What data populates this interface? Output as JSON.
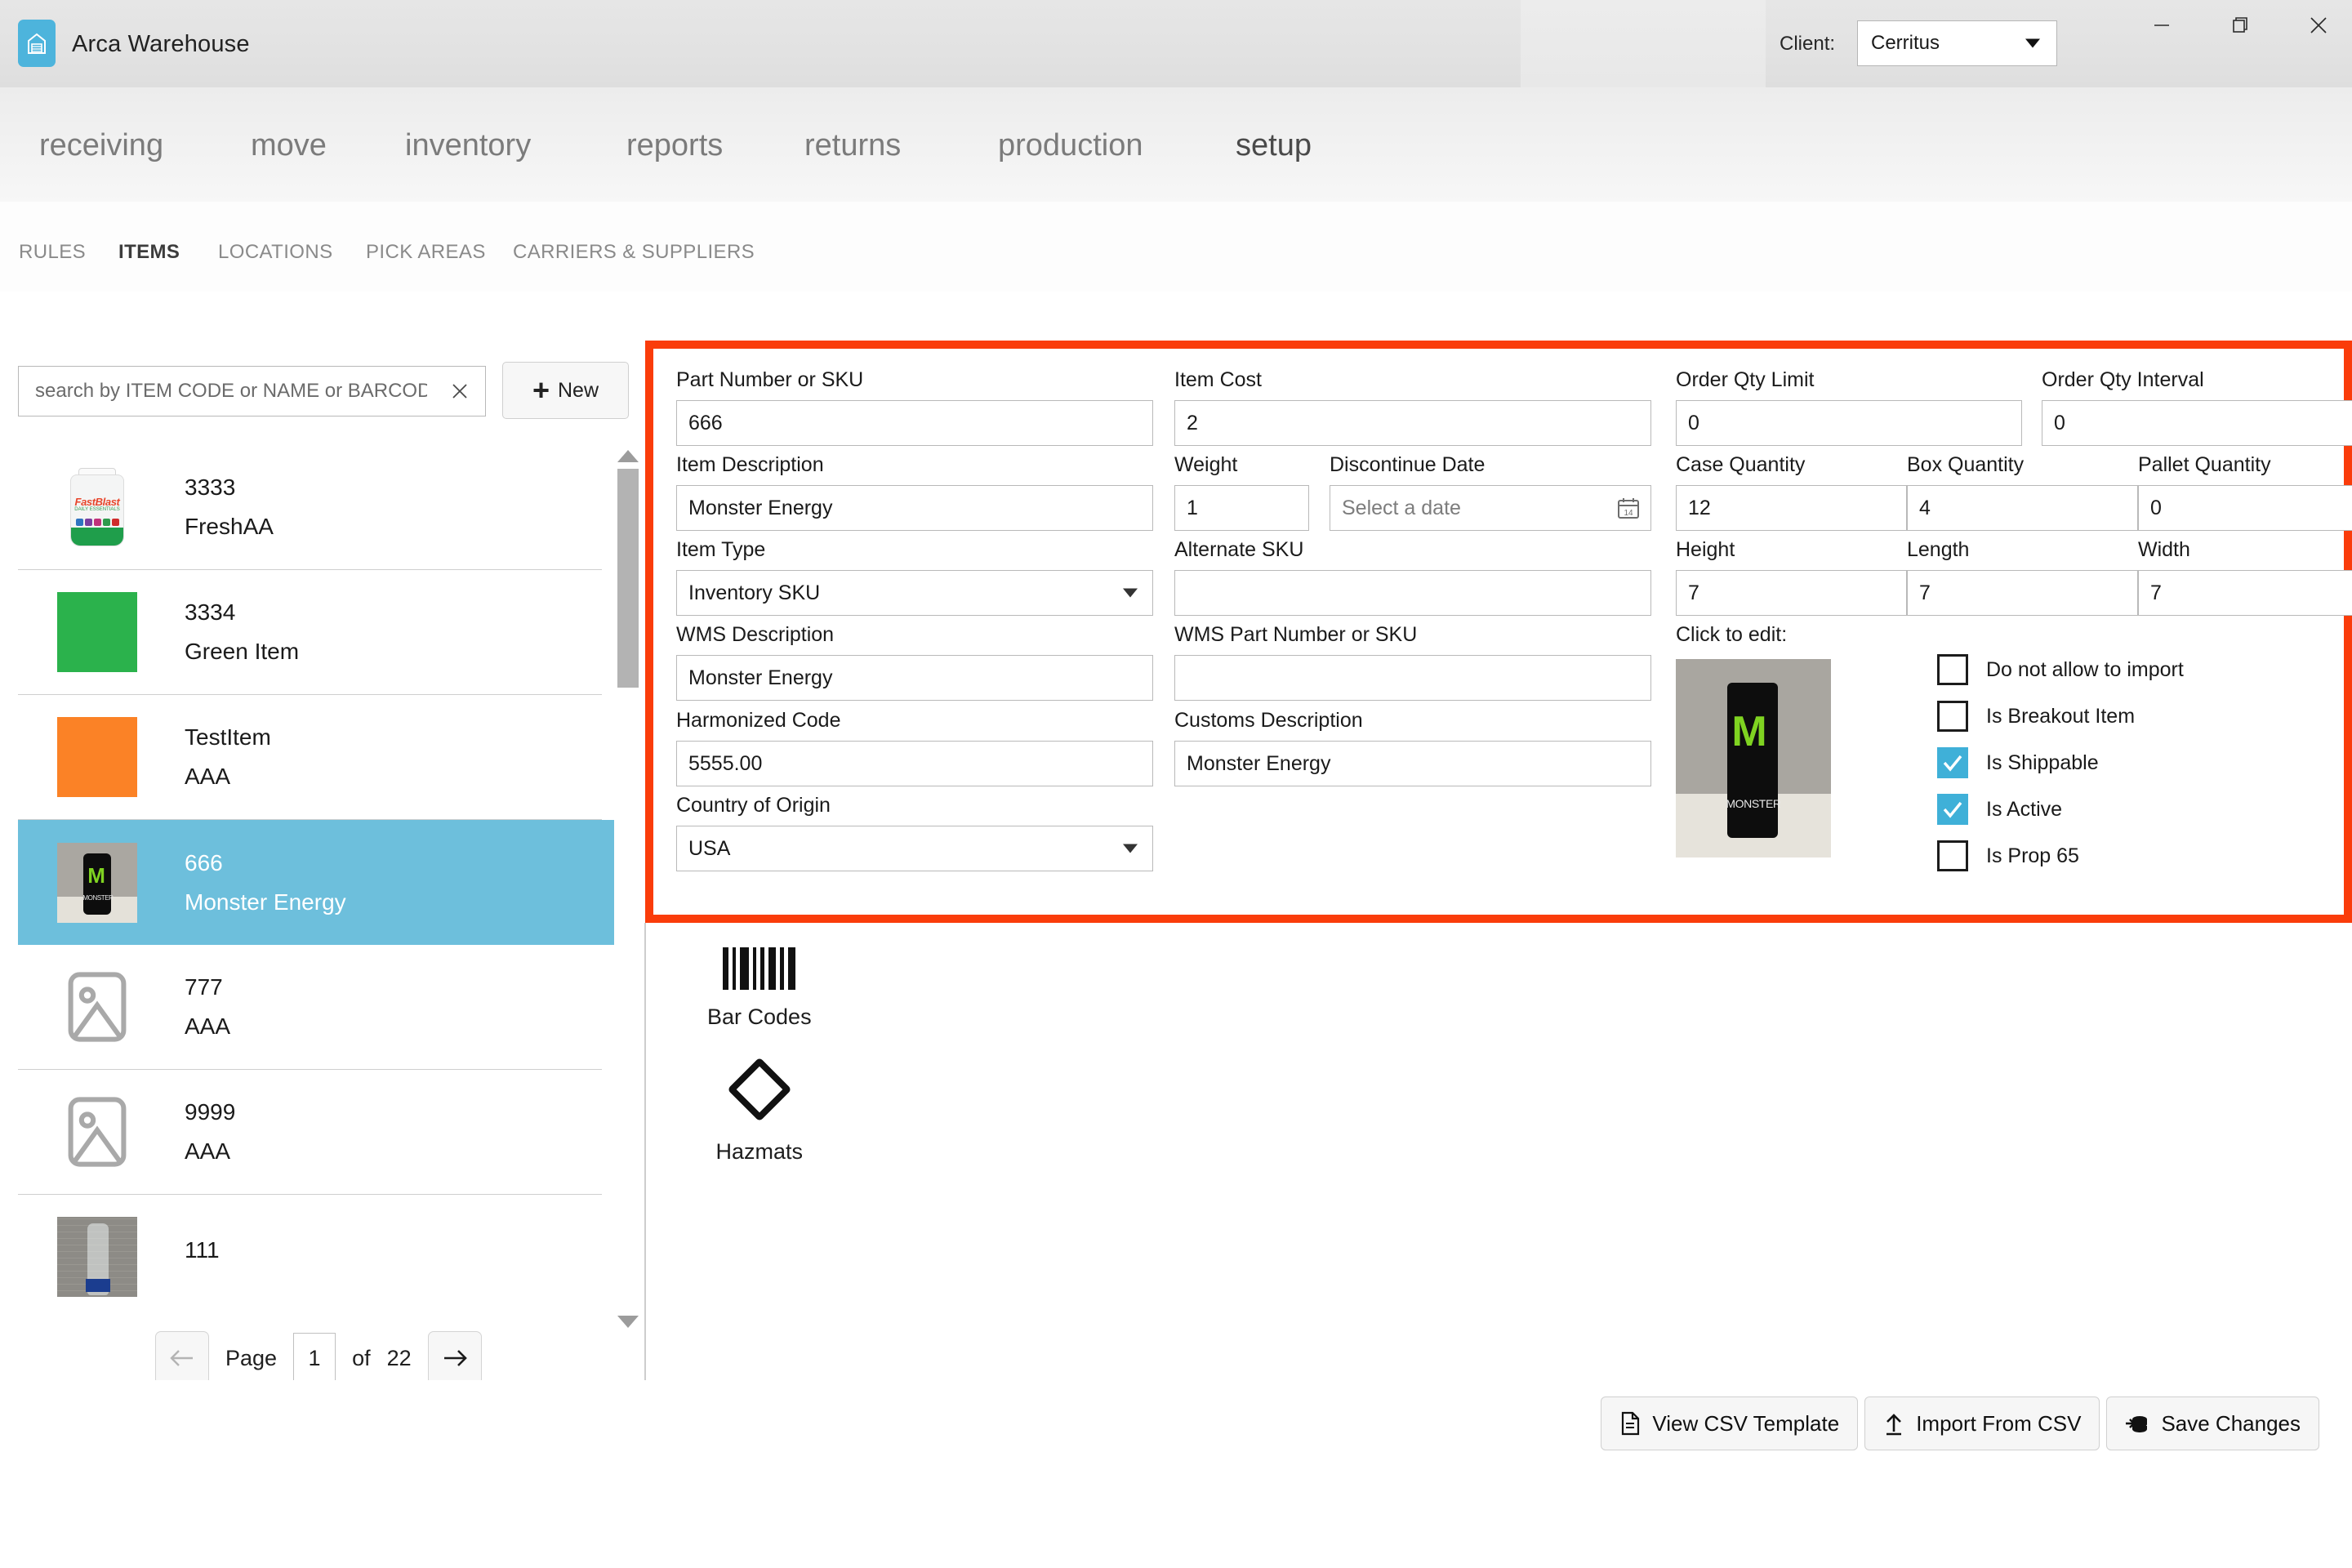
{
  "titlebar": {
    "app_title": "Arca Warehouse",
    "app_icon": "warehouse-icon",
    "client_label": "Client:",
    "client_value": "Cerritus",
    "minimize": "–",
    "maximize": "❐",
    "close": "✕"
  },
  "main_nav": [
    {
      "label": "receiving",
      "active": false
    },
    {
      "label": "move",
      "active": false
    },
    {
      "label": "inventory",
      "active": false
    },
    {
      "label": "reports",
      "active": false
    },
    {
      "label": "returns",
      "active": false
    },
    {
      "label": "production",
      "active": false
    },
    {
      "label": "setup",
      "active": true
    }
  ],
  "sub_nav": [
    {
      "label": "RULES",
      "active": false
    },
    {
      "label": "ITEMS",
      "active": true
    },
    {
      "label": "LOCATIONS",
      "active": false
    },
    {
      "label": "PICK AREAS",
      "active": false
    },
    {
      "label": "CARRIERS & SUPPLIERS",
      "active": false
    }
  ],
  "sidebar": {
    "search_placeholder": "search by ITEM CODE or NAME or BARCODE",
    "search_value": "",
    "clear_icon": "close-icon",
    "new_button": "New",
    "items": [
      {
        "code": "3333",
        "name": "FreshAA",
        "thumb": "fastblast-bottle",
        "selected": false
      },
      {
        "code": "3334",
        "name": "Green Item",
        "thumb": "green-swatch",
        "selected": false
      },
      {
        "code": "TestItem",
        "name": "AAA",
        "thumb": "orange-swatch",
        "selected": false
      },
      {
        "code": "666",
        "name": "Monster Energy",
        "thumb": "monster-can-photo",
        "selected": true
      },
      {
        "code": "777",
        "name": "AAA",
        "thumb": "image-placeholder",
        "selected": false
      },
      {
        "code": "9999",
        "name": "AAA",
        "thumb": "image-placeholder",
        "selected": false
      },
      {
        "code": "111",
        "name": "",
        "thumb": "water-bottle-photo",
        "selected": false
      }
    ],
    "pager": {
      "prev_icon": "arrow-left-icon",
      "page_label": "Page",
      "page_value": "1",
      "of_label": "of",
      "total_pages": "22",
      "next_icon": "arrow-right-icon"
    }
  },
  "form": {
    "highlight_color": "#fa3c0a",
    "part_number_label": "Part Number or SKU",
    "part_number_value": "666",
    "item_description_label": "Item Description",
    "item_description_value": "Monster Energy",
    "item_type_label": "Item Type",
    "item_type_value": "Inventory SKU",
    "wms_description_label": "WMS Description",
    "wms_description_value": "Monster Energy",
    "harmonized_code_label": "Harmonized Code",
    "harmonized_code_value": "5555.00",
    "country_of_origin_label": "Country of Origin",
    "country_of_origin_value": "USA",
    "item_cost_label": "Item Cost",
    "item_cost_value": "2",
    "weight_label": "Weight",
    "weight_value": "1",
    "discontinue_date_label": "Discontinue Date",
    "discontinue_date_placeholder": "Select a date",
    "discontinue_date_value": "",
    "alternate_sku_label": "Alternate SKU",
    "alternate_sku_value": "",
    "wms_part_number_label": "WMS Part Number or SKU",
    "wms_part_number_value": "",
    "customs_description_label": "Customs Description",
    "customs_description_value": "Monster Energy",
    "order_qty_limit_label": "Order Qty Limit",
    "order_qty_limit_value": "0",
    "order_qty_interval_label": "Order Qty Interval",
    "order_qty_interval_value": "0",
    "case_quantity_label": "Case Quantity",
    "case_quantity_value": "12",
    "box_quantity_label": "Box Quantity",
    "box_quantity_value": "4",
    "pallet_quantity_label": "Pallet Quantity",
    "pallet_quantity_value": "0",
    "height_label": "Height",
    "height_value": "7",
    "length_label": "Length",
    "length_value": "7",
    "width_label": "Width",
    "width_value": "7",
    "click_to_edit_label": "Click to edit:",
    "image_alt": "monster-energy-can-photo",
    "checkbox_checked_color": "#3fb0d8",
    "checkboxes": [
      {
        "label": "Do not allow to import",
        "checked": false
      },
      {
        "label": "Is Breakout Item",
        "checked": false
      },
      {
        "label": "Is Shippable",
        "checked": true
      },
      {
        "label": "Is Active",
        "checked": true
      },
      {
        "label": "Is Prop 65",
        "checked": false
      }
    ]
  },
  "sections": [
    {
      "icon": "barcode-icon",
      "caption": "Bar Codes"
    },
    {
      "icon": "hazmat-diamond-icon",
      "caption": "Hazmats"
    }
  ],
  "actions": [
    {
      "icon": "file-icon",
      "label": "View CSV Template"
    },
    {
      "icon": "upload-icon",
      "label": "Import From CSV"
    },
    {
      "icon": "database-save-icon",
      "label": "Save Changes"
    }
  ]
}
